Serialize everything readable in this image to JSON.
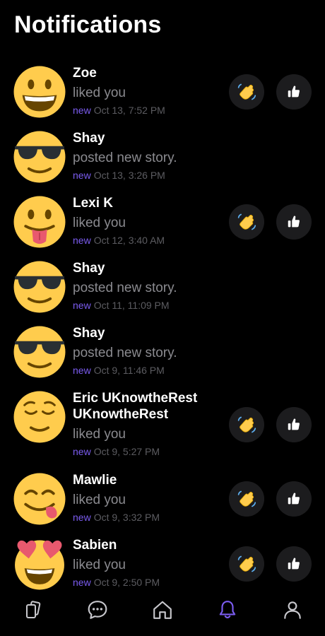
{
  "header": {
    "title": "Notifications"
  },
  "colors": {
    "accent": "#7b5cf0",
    "secondary_text": "#8a8a8f",
    "muted_text": "#5c5c61",
    "button_bg": "#1c1c1e"
  },
  "notifications": [
    {
      "avatar_icon": "grinning-face-icon",
      "name": "Zoe",
      "message": "liked you",
      "badge": "new",
      "time": "Oct 13, 7:52 PM",
      "has_actions": true
    },
    {
      "avatar_icon": "sunglasses-face-icon",
      "name": "Shay",
      "message": "posted new story.",
      "badge": "new",
      "time": "Oct 13, 3:26 PM",
      "has_actions": false
    },
    {
      "avatar_icon": "tongue-face-icon",
      "name": "Lexi K",
      "message": "liked you",
      "badge": "new",
      "time": "Oct 12, 3:40 AM",
      "has_actions": true
    },
    {
      "avatar_icon": "sunglasses-face-icon",
      "name": "Shay",
      "message": "posted new story.",
      "badge": "new",
      "time": "Oct 11, 11:09 PM",
      "has_actions": false
    },
    {
      "avatar_icon": "sunglasses-face-icon",
      "name": "Shay",
      "message": "posted new story.",
      "badge": "new",
      "time": "Oct 9, 11:46 PM",
      "has_actions": false
    },
    {
      "avatar_icon": "relieved-face-icon",
      "name_lines": [
        "Eric UKnowtheRest",
        "UKnowtheRest"
      ],
      "message": "liked you",
      "badge": "new",
      "time": "Oct 9, 5:27 PM",
      "has_actions": true
    },
    {
      "avatar_icon": "yum-face-icon",
      "name": "Mawlie",
      "message": "liked you",
      "badge": "new",
      "time": "Oct 9, 3:32 PM",
      "has_actions": true
    },
    {
      "avatar_icon": "heart-eyes-face-icon",
      "name": "Sabien",
      "message": "liked you",
      "badge": "new",
      "time": "Oct 9, 2:50 PM",
      "has_actions": true
    }
  ],
  "actions": {
    "wave_icon": "waving-hand-icon",
    "like_icon": "thumbs-up-icon"
  },
  "tabbar": [
    {
      "icon": "cards-icon",
      "active": false
    },
    {
      "icon": "chat-bubble-icon",
      "active": false
    },
    {
      "icon": "home-icon",
      "active": false
    },
    {
      "icon": "bell-icon",
      "active": true
    },
    {
      "icon": "profile-icon",
      "active": false
    }
  ]
}
